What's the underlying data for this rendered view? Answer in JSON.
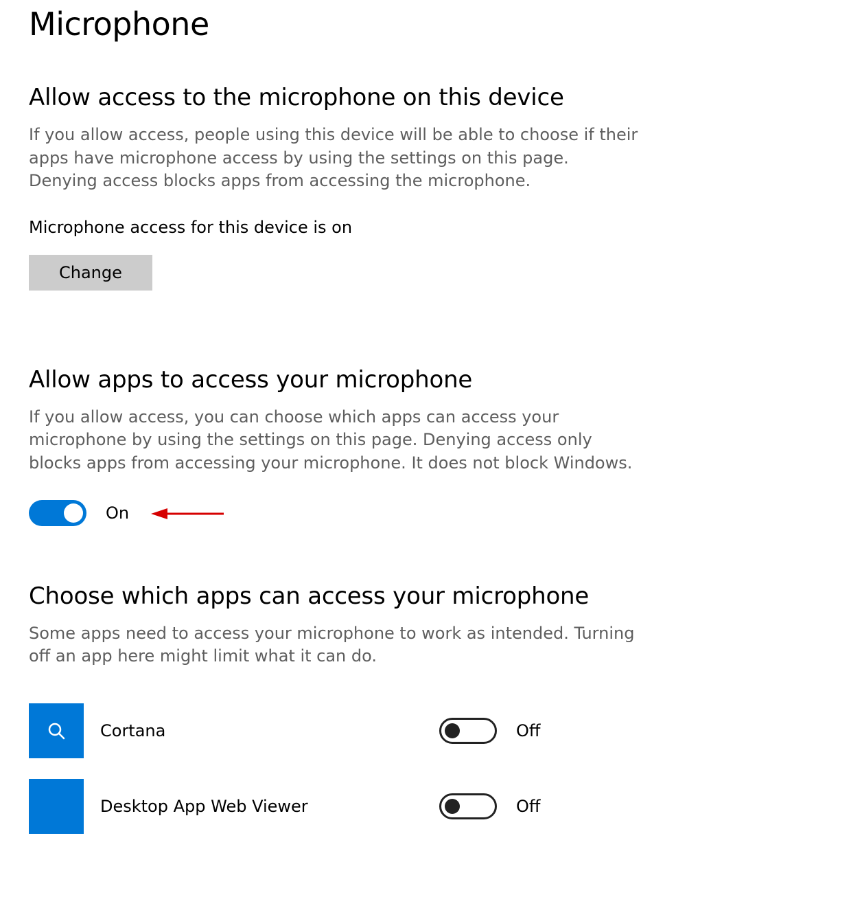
{
  "page": {
    "title": "Microphone"
  },
  "section1": {
    "heading": "Allow access to the microphone on this device",
    "desc": "If you allow access, people using this device will be able to choose if their apps have microphone access by using the settings on this page. Denying access blocks apps from accessing the microphone.",
    "status": "Microphone access for this device is on",
    "change_label": "Change"
  },
  "section2": {
    "heading": "Allow apps to access your microphone",
    "desc": "If you allow access, you can choose which apps can access your microphone by using the settings on this page. Denying access only blocks apps from accessing your microphone. It does not block Windows.",
    "toggle_state": "On"
  },
  "section3": {
    "heading": "Choose which apps can access your microphone",
    "desc": "Some apps need to access your microphone to work as intended. Turning off an app here might limit what it can do.",
    "apps": [
      {
        "name": "Cortana",
        "state": "Off",
        "icon": "search"
      },
      {
        "name": "Desktop App Web Viewer",
        "state": "Off",
        "icon": "blank"
      }
    ]
  },
  "colors": {
    "accent": "#0078d7",
    "annotation": "#d60000"
  }
}
